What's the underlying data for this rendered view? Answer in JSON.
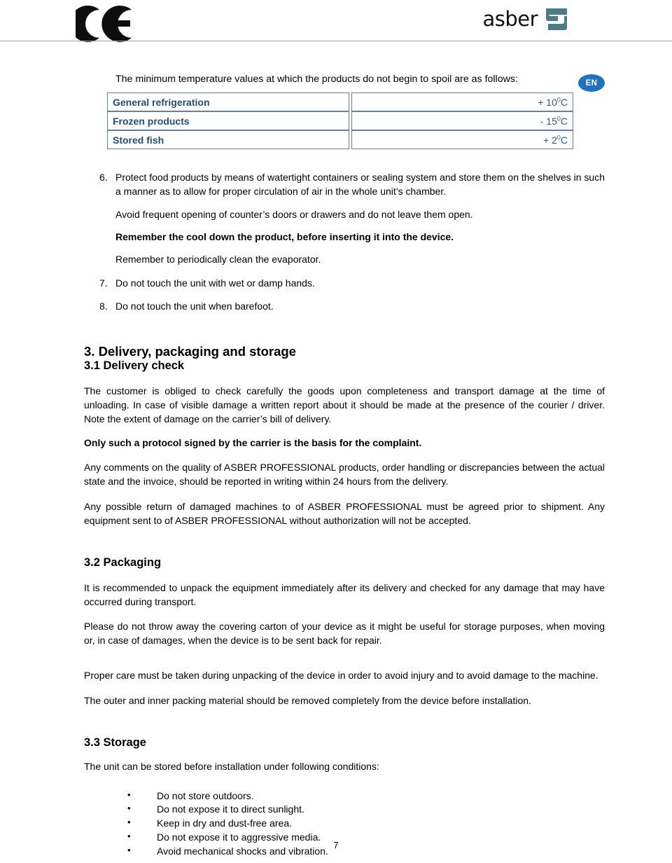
{
  "header": {
    "ce_mark_label": "CE",
    "brand_name": "asber",
    "brand_glyph_color": "#4d7b85"
  },
  "language_badge": "EN",
  "intro_line": "The minimum temperature values at which the products do not begin to spoil are as follows:",
  "temperature_table": {
    "rows": [
      {
        "label": "General refrigeration",
        "value_prefix": "+ 10",
        "value_sup": "0",
        "value_unit": "C"
      },
      {
        "label": "Frozen products",
        "value_prefix": "- 15",
        "value_sup": "0",
        "value_unit": "C"
      },
      {
        "label": "Stored fish",
        "value_prefix": "+ 2",
        "value_sup": "0",
        "value_unit": "C"
      }
    ]
  },
  "numbered_items": [
    {
      "marker": "6.",
      "text": "Protect food products by means of watertight containers or sealing system and store them on the shelves in such a manner as to allow for proper circulation of air in the whole unit’s chamber."
    },
    {
      "marker": "7.",
      "text": "Do not touch the unit with wet or damp hands."
    },
    {
      "marker": "8.",
      "text": "Do not touch the unit when barefoot."
    }
  ],
  "item6_subparagraphs": [
    {
      "text": "Avoid frequent opening of counter’s doors or drawers and do not leave them open.",
      "bold": false
    },
    {
      "text": "Remember the cool down the product, before inserting it into the device.",
      "bold": true
    },
    {
      "text": "Remember to periodically clean the evaporator.",
      "bold": false
    }
  ],
  "section3": {
    "title": "3. Delivery, packaging and storage",
    "sub1_title": "3.1 Delivery check",
    "sub1_paragraphs": [
      {
        "text": "The customer is obliged to check carefully the goods upon completeness and transport damage at the time of unloading. In case of visible damage a written report about it should be made at the presence of  the courier / driver. Note the extent of damage on the carrier’s bill of delivery.",
        "bold": false
      },
      {
        "text": "Only such a protocol signed by the carrier is the basis for the complaint.",
        "bold": true
      },
      {
        "text": "Any comments on the quality of ASBER PROFESSIONAL products, order handling or discrepancies between the actual state and the invoice, should be reported in writing within 24 hours from the delivery.",
        "bold": false
      },
      {
        "text": "Any possible return of damaged machines to of ASBER PROFESSIONAL must be agreed prior to shipment. Any equipment sent to of ASBER PROFESSIONAL without authorization will not be accepted.",
        "bold": false
      }
    ],
    "sub2_title": "3.2 Packaging",
    "sub2_paragraphs": [
      {
        "text": "It is recommended to unpack the equipment immediately after its delivery and checked for any damage that may have occurred during transport.",
        "bold": false
      },
      {
        "text": "Please do not throw away the covering carton of your device as it might be useful for storage purposes, when moving or, in case of damages, when the device is to be sent back for repair.",
        "bold": false
      },
      {
        "text": "Proper care must be taken during unpacking of  the device in order to avoid injury and to avoid damage to the machine.",
        "bold": false
      },
      {
        "text": "The outer and inner packing material should be removed completely from the device before installation.",
        "bold": false
      }
    ],
    "sub3_title": "3.3 Storage",
    "sub3_intro": "The unit can be stored before installation under following conditions:",
    "sub3_bullets": [
      "Do not store outdoors.",
      "Do not expose it to direct sunlight.",
      "Keep in dry and dust-free area.",
      "Do not expose it to aggressive media.",
      "Avoid mechanical shocks and vibration."
    ]
  },
  "page_number": "7"
}
